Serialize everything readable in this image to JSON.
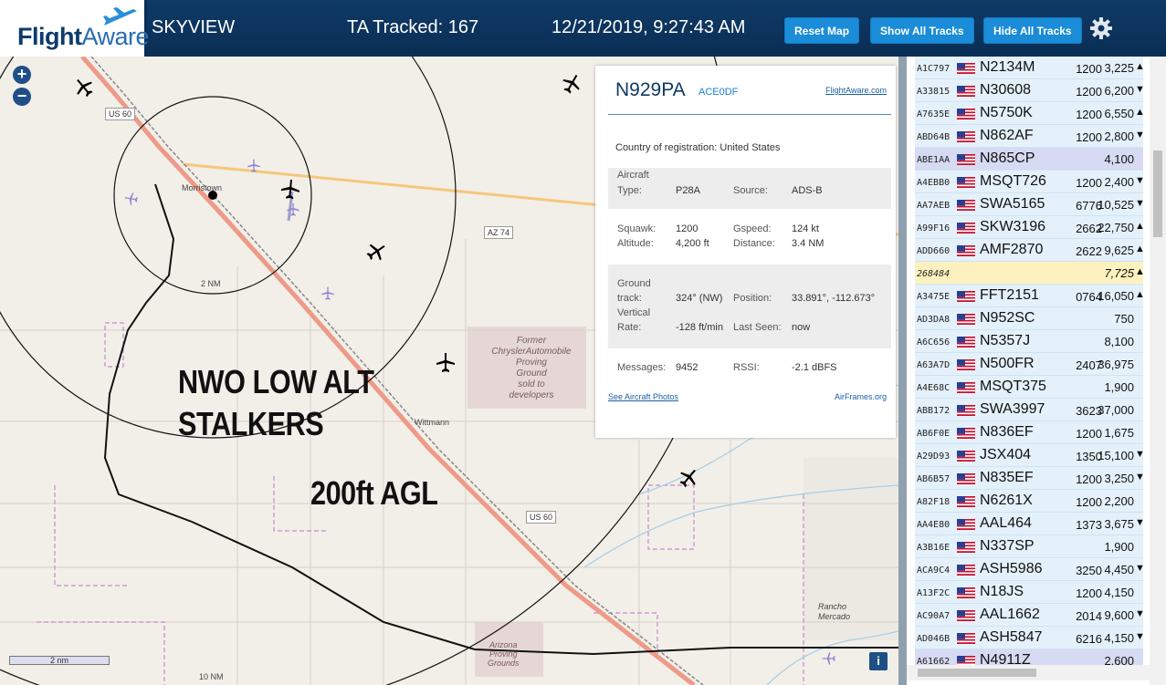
{
  "header": {
    "logo_part1": "Flight",
    "logo_part2": "Aware",
    "app_name": "SKYVIEW",
    "tracked": "TA Tracked: 167",
    "datetime": "12/21/2019, 9:27:43 AM",
    "buttons": {
      "reset": "Reset Map",
      "show": "Show All Tracks",
      "hide": "Hide All Tracks"
    },
    "settings_icon": "gear-icon"
  },
  "map": {
    "zoom_in": "+",
    "zoom_out": "−",
    "labels": {
      "us60_top": "US 60",
      "us60_bottom": "US 60",
      "az74": "AZ 74",
      "morristown": "Morristown",
      "wittmann": "Wittmann",
      "ring_2nm": "2 NM",
      "ring_10nm": "10 NM",
      "former_chrysler": "Former\nChryslerAutomobile\nProving\nGround\nsold to\ndevelopers",
      "rancho": "Rancho\nMercado",
      "arizona_pg": "Arizona\nProving\nGrounds",
      "scale": "2 nm"
    },
    "overlay_line1": "NWO LOW ALT",
    "overlay_line2": "STALKERS",
    "overlay_agl": "200ft AGL",
    "info": "i"
  },
  "popup": {
    "registration": "N929PA",
    "hex": "ACE0DF",
    "fa_link": "FlightAware.com",
    "country_label": "Country of registration:",
    "country": "United States",
    "aircraft_label": "Aircraft",
    "type_label": "Type:",
    "type": "P28A",
    "source_label": "Source:",
    "source": "ADS-B",
    "squawk_label": "Squawk:",
    "squawk": "1200",
    "gspeed_label": "Gspeed:",
    "gspeed": "124 kt",
    "altitude_label": "Altitude:",
    "altitude": "4,200 ft",
    "distance_label": "Distance:",
    "distance": "3.4 NM",
    "ground_label": "Ground",
    "track_label": "track:",
    "track": "324° (NW)",
    "position_label": "Position:",
    "position": "33.891°, -112.673°",
    "vertical_label": "Vertical",
    "rate_label": "Rate:",
    "rate": "-128 ft/min",
    "lastseen_label": "Last Seen:",
    "lastseen": "now",
    "messages_label": "Messages:",
    "messages": "9452",
    "rssi_label": "RSSI:",
    "rssi": "-2.1 dBFS",
    "photos_link": "See Aircraft Photos",
    "airframes_link": "AirFrames.org"
  },
  "list": {
    "rows": [
      {
        "hex": "A1C797",
        "id": "N2134M",
        "squawk": "1200",
        "alt": "3,225",
        "arrow": "▲",
        "flag": true,
        "state": ""
      },
      {
        "hex": "A33815",
        "id": "N30608",
        "squawk": "1200",
        "alt": "6,200",
        "arrow": "▼",
        "flag": true,
        "state": ""
      },
      {
        "hex": "A7635E",
        "id": "N5750K",
        "squawk": "1200",
        "alt": "6,550",
        "arrow": "▲",
        "flag": true,
        "state": ""
      },
      {
        "hex": "ABD64B",
        "id": "N862AF",
        "squawk": "1200",
        "alt": "2,800",
        "arrow": "▼",
        "flag": true,
        "state": ""
      },
      {
        "hex": "ABE1AA",
        "id": "N865CP",
        "squawk": "",
        "alt": "4,100",
        "arrow": "",
        "flag": true,
        "state": "sel"
      },
      {
        "hex": "A4EBB0",
        "id": "MSQT726",
        "squawk": "1200",
        "alt": "2,400",
        "arrow": "▼",
        "flag": true,
        "state": ""
      },
      {
        "hex": "AA7AEB",
        "id": "SWA5165",
        "squawk": "6776",
        "alt": "10,525",
        "arrow": "▼",
        "flag": true,
        "state": ""
      },
      {
        "hex": "A99F16",
        "id": "SKW3196",
        "squawk": "2662",
        "alt": "22,750",
        "arrow": "▲",
        "flag": true,
        "state": ""
      },
      {
        "hex": "ADD660",
        "id": "AMF2870",
        "squawk": "2622",
        "alt": "9,625",
        "arrow": "▲",
        "flag": true,
        "state": ""
      },
      {
        "hex": "268484",
        "id": "",
        "squawk": "",
        "alt": "7,725",
        "arrow": "▲",
        "flag": false,
        "state": "yel"
      },
      {
        "hex": "A3475E",
        "id": "FFT2151",
        "squawk": "0764",
        "alt": "16,050",
        "arrow": "▲",
        "flag": true,
        "state": ""
      },
      {
        "hex": "AD3DA8",
        "id": "N952SC",
        "squawk": "",
        "alt": "750",
        "arrow": "",
        "flag": true,
        "state": ""
      },
      {
        "hex": "A6C656",
        "id": "N5357J",
        "squawk": "",
        "alt": "8,100",
        "arrow": "",
        "flag": true,
        "state": ""
      },
      {
        "hex": "A63A7D",
        "id": "N500FR",
        "squawk": "2407",
        "alt": "36,975",
        "arrow": "",
        "flag": true,
        "state": ""
      },
      {
        "hex": "A4E68C",
        "id": "MSQT375",
        "squawk": "",
        "alt": "1,900",
        "arrow": "",
        "flag": true,
        "state": ""
      },
      {
        "hex": "ABB172",
        "id": "SWA3997",
        "squawk": "3623",
        "alt": "37,000",
        "arrow": "",
        "flag": true,
        "state": ""
      },
      {
        "hex": "AB6F0E",
        "id": "N836EF",
        "squawk": "1200",
        "alt": "1,675",
        "arrow": "",
        "flag": true,
        "state": ""
      },
      {
        "hex": "A29D93",
        "id": "JSX404",
        "squawk": "1350",
        "alt": "15,100",
        "arrow": "▼",
        "flag": true,
        "state": ""
      },
      {
        "hex": "AB6B57",
        "id": "N835EF",
        "squawk": "1200",
        "alt": "3,250",
        "arrow": "▼",
        "flag": true,
        "state": ""
      },
      {
        "hex": "A82F18",
        "id": "N6261X",
        "squawk": "1200",
        "alt": "2,200",
        "arrow": "",
        "flag": true,
        "state": ""
      },
      {
        "hex": "AA4E80",
        "id": "AAL464",
        "squawk": "1373",
        "alt": "3,675",
        "arrow": "▼",
        "flag": true,
        "state": ""
      },
      {
        "hex": "A3B16E",
        "id": "N337SP",
        "squawk": "",
        "alt": "1,900",
        "arrow": "",
        "flag": true,
        "state": ""
      },
      {
        "hex": "ACA9C4",
        "id": "ASH5986",
        "squawk": "3250",
        "alt": "4,450",
        "arrow": "▼",
        "flag": true,
        "state": ""
      },
      {
        "hex": "A13F2C",
        "id": "N18JS",
        "squawk": "1200",
        "alt": "4,150",
        "arrow": "",
        "flag": true,
        "state": ""
      },
      {
        "hex": "AC90A7",
        "id": "AAL1662",
        "squawk": "2014",
        "alt": "9,600",
        "arrow": "▼",
        "flag": true,
        "state": ""
      },
      {
        "hex": "AD046B",
        "id": "ASH5847",
        "squawk": "6216",
        "alt": "4,150",
        "arrow": "▼",
        "flag": true,
        "state": ""
      },
      {
        "hex": "A61662",
        "id": "N4911Z",
        "squawk": "",
        "alt": "2,600",
        "arrow": "",
        "flag": true,
        "state": "sel"
      }
    ]
  },
  "colors": {
    "header": "#0f3a66",
    "button": "#1a8cd8",
    "row": "#e4f1fb",
    "selected_row": "#d6daf2",
    "yellow_row": "#fdf2bf"
  }
}
